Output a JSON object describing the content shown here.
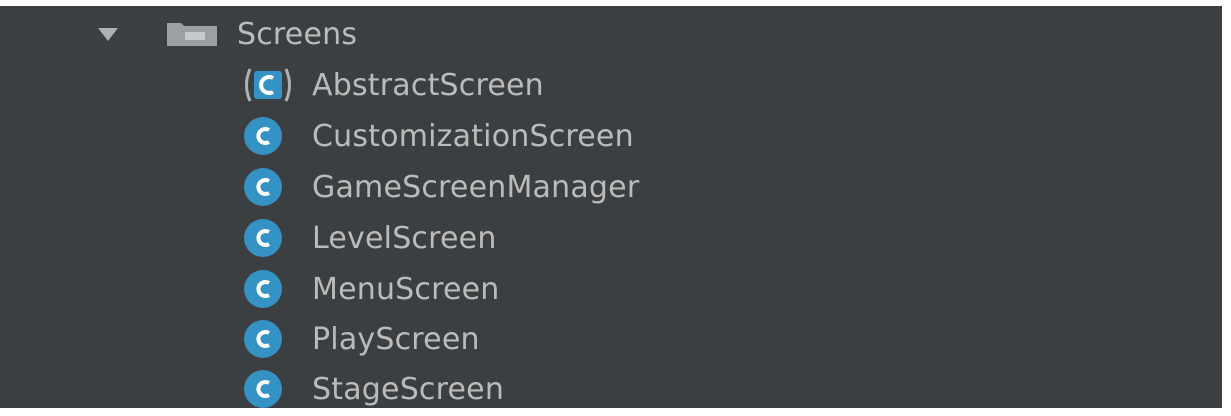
{
  "tree": {
    "folder": {
      "label": "Screens",
      "expanded": true,
      "chevron_icon": "chevron-down-icon",
      "icon": "folder-icon"
    },
    "items": [
      {
        "label": "AbstractScreen",
        "icon": "abstract-class-icon"
      },
      {
        "label": "CustomizationScreen",
        "icon": "class-icon"
      },
      {
        "label": "GameScreenManager",
        "icon": "class-icon"
      },
      {
        "label": "LevelScreen",
        "icon": "class-icon"
      },
      {
        "label": "MenuScreen",
        "icon": "class-icon"
      },
      {
        "label": "PlayScreen",
        "icon": "class-icon"
      },
      {
        "label": "StageScreen",
        "icon": "class-icon"
      }
    ]
  },
  "colors": {
    "panel_background": "#3c3f41",
    "text": "#bbbbbb",
    "class_icon": "#3592c4",
    "folder_icon": "#9da0a2"
  }
}
